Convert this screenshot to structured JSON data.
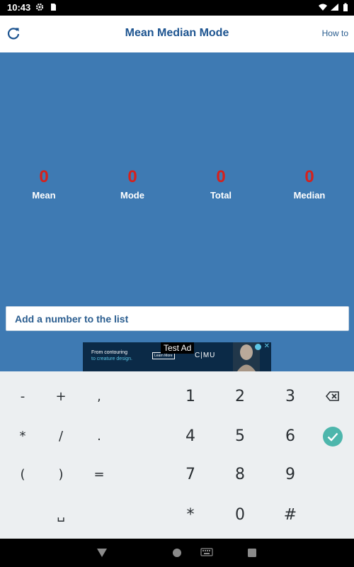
{
  "status_bar": {
    "time": "10:43"
  },
  "app_bar": {
    "title": "Mean Median Mode",
    "how_to_label": "How to"
  },
  "stats": [
    {
      "value": "0",
      "label": "Mean"
    },
    {
      "value": "0",
      "label": "Mode"
    },
    {
      "value": "0",
      "label": "Total"
    },
    {
      "value": "0",
      "label": "Median"
    }
  ],
  "input": {
    "placeholder": "Add a number to the list"
  },
  "ad": {
    "line1": "From contouring",
    "line2": "to creature design.",
    "button": "Learn More",
    "badge": "Test Ad",
    "brand": "C|MU"
  },
  "keyboard": {
    "left_rows": [
      [
        "-",
        "+",
        ","
      ],
      [
        "*",
        "/",
        "."
      ],
      [
        "(",
        ")",
        "="
      ],
      [
        "",
        "␣",
        ""
      ]
    ],
    "right_rows": [
      [
        "1",
        "2",
        "3"
      ],
      [
        "4",
        "5",
        "6"
      ],
      [
        "7",
        "8",
        "9"
      ],
      [
        "*",
        "0",
        "#"
      ]
    ],
    "backspace_icon": "backspace-icon",
    "enter_icon": "check-icon"
  },
  "colors": {
    "panel": "#3e7ab3",
    "value_red": "#d5211d",
    "title_blue": "#1d5490",
    "accept_green": "#4db6ac"
  }
}
